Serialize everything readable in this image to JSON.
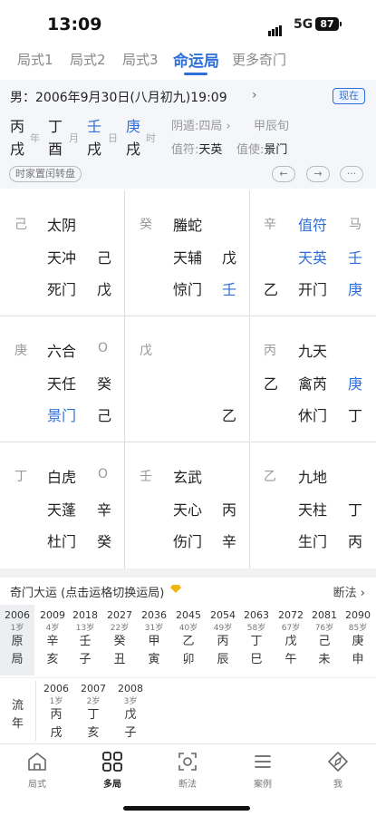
{
  "status_bar": {
    "time": "13:09",
    "network": "5G",
    "battery": "87"
  },
  "tabs": [
    {
      "label": "局式1"
    },
    {
      "label": "局式2"
    },
    {
      "label": "局式3"
    },
    {
      "label": "命运局"
    },
    {
      "label": "更多奇门"
    }
  ],
  "info": {
    "datetime": "男：2006年9月30日(八月初九)19:09",
    "now_button": "现在",
    "pillars": {
      "year": {
        "stem": "丙",
        "branch": "戌",
        "label": "年"
      },
      "month": {
        "stem": "丁",
        "branch": "酉",
        "label": "月"
      },
      "day": {
        "stem": "壬",
        "branch": "戌",
        "label": "日"
      },
      "hour": {
        "stem": "庚",
        "branch": "戌",
        "label": "时"
      }
    },
    "ju": "阴遁:四局",
    "xun": "甲辰旬",
    "zhifu_label": "值符:",
    "zhifu": "天英",
    "zhishi_label": "值使:",
    "zhishi": "景门",
    "toggle_button": "时家置闰转盘",
    "nav_prev": "←",
    "nav_next": "→",
    "nav_more": "···"
  },
  "palaces": [
    {
      "tl": "己",
      "god": "太阴",
      "star": "天冲",
      "star_stem": "己",
      "door": "死门",
      "door_stem": "戊"
    },
    {
      "tl": "癸",
      "god": "螣蛇",
      "star": "天辅",
      "star_stem": "戊",
      "door": "惊门",
      "door_stem": "壬"
    },
    {
      "tl": "辛",
      "god": "值符",
      "tr": "马",
      "star": "天英",
      "star_stem": "壬",
      "door_left": "乙",
      "door": "开门",
      "door_stem": "庚"
    },
    {
      "tl": "庚",
      "god": "六合",
      "tr": "O",
      "star": "天任",
      "star_stem": "癸",
      "door": "景门",
      "door_stem": "己"
    },
    {
      "tl": "戊",
      "bottom": "乙"
    },
    {
      "tl": "丙",
      "god": "九天",
      "star_left": "乙",
      "star": "禽芮",
      "star_stem": "庚",
      "door": "休门",
      "door_stem": "丁"
    },
    {
      "tl": "丁",
      "god": "白虎",
      "tr": "O",
      "star": "天蓬",
      "star_stem": "辛",
      "door": "杜门",
      "door_stem": "癸"
    },
    {
      "tl": "壬",
      "god": "玄武",
      "star": "天心",
      "star_stem": "丙",
      "door": "伤门",
      "door_stem": "辛"
    },
    {
      "tl": "乙",
      "god": "九地",
      "star": "天柱",
      "star_stem": "丁",
      "door": "生门",
      "door_stem": "丙"
    }
  ],
  "luck": {
    "title": "奇门大运 (点击运格切换运局)",
    "link": "断法",
    "columns": [
      {
        "year": "2006",
        "age": "1岁",
        "g1": "原",
        "g2": "局"
      },
      {
        "year": "2009",
        "age": "4岁",
        "g1": "辛",
        "g2": "亥"
      },
      {
        "year": "2018",
        "age": "13岁",
        "g1": "壬",
        "g2": "子"
      },
      {
        "year": "2027",
        "age": "22岁",
        "g1": "癸",
        "g2": "丑"
      },
      {
        "year": "2036",
        "age": "31岁",
        "g1": "甲",
        "g2": "寅"
      },
      {
        "year": "2045",
        "age": "40岁",
        "g1": "乙",
        "g2": "卯"
      },
      {
        "year": "2054",
        "age": "49岁",
        "g1": "丙",
        "g2": "辰"
      },
      {
        "year": "2063",
        "age": "58岁",
        "g1": "丁",
        "g2": "巳"
      },
      {
        "year": "2072",
        "age": "67岁",
        "g1": "戊",
        "g2": "午"
      },
      {
        "year": "2081",
        "age": "76岁",
        "g1": "己",
        "g2": "未"
      },
      {
        "year": "2090",
        "age": "85岁",
        "g1": "庚",
        "g2": "申"
      }
    ],
    "liunian_label": "流年",
    "liunian": [
      {
        "year": "2006",
        "age": "1岁",
        "g1": "丙",
        "g2": "戌"
      },
      {
        "year": "2007",
        "age": "2岁",
        "g1": "丁",
        "g2": "亥"
      },
      {
        "year": "2008",
        "age": "3岁",
        "g1": "戊",
        "g2": "子"
      }
    ]
  },
  "bottom_nav": [
    {
      "label": "局式",
      "icon": "home-icon"
    },
    {
      "label": "多局",
      "icon": "grid-icon"
    },
    {
      "label": "断法",
      "icon": "scan-icon"
    },
    {
      "label": "案例",
      "icon": "list-icon"
    },
    {
      "label": "我",
      "icon": "compass-icon"
    }
  ]
}
